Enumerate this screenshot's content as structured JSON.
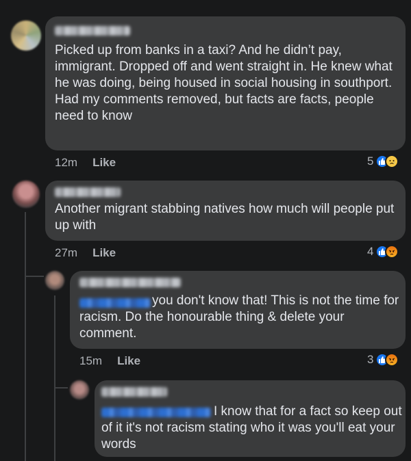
{
  "comments": [
    {
      "text": "Picked up from banks in a taxi? And he didn’t pay, immigrant. Dropped off and went straight in. He knew what he was doing, being housed in social housing in southport.\nHad my comments removed, but facts are facts, people need to know",
      "time": "12m",
      "like_label": "Like",
      "reaction_count": "5",
      "reactions": [
        "like-icon",
        "sad-face-icon"
      ]
    },
    {
      "text": "Another migrant stabbing natives how much will people put up with",
      "time": "27m",
      "like_label": "Like",
      "reaction_count": "4",
      "reactions": [
        "like-icon",
        "angry-face-icon"
      ]
    },
    {
      "text": "you don't know that! This is not the time for racism. Do the honourable thing & delete your comment.",
      "time": "15m",
      "like_label": "Like",
      "reaction_count": "3",
      "reactions": [
        "like-icon",
        "angry-face-icon"
      ]
    },
    {
      "text": "I know that for a fact so keep out of it it's not racism stating who it was you'll eat your words"
    }
  ],
  "colors": {
    "background": "#18191a",
    "bubble": "#3a3b3c",
    "text": "#e4e6eb",
    "meta": "#b0b3b8",
    "like_blue": "#1877f2"
  }
}
